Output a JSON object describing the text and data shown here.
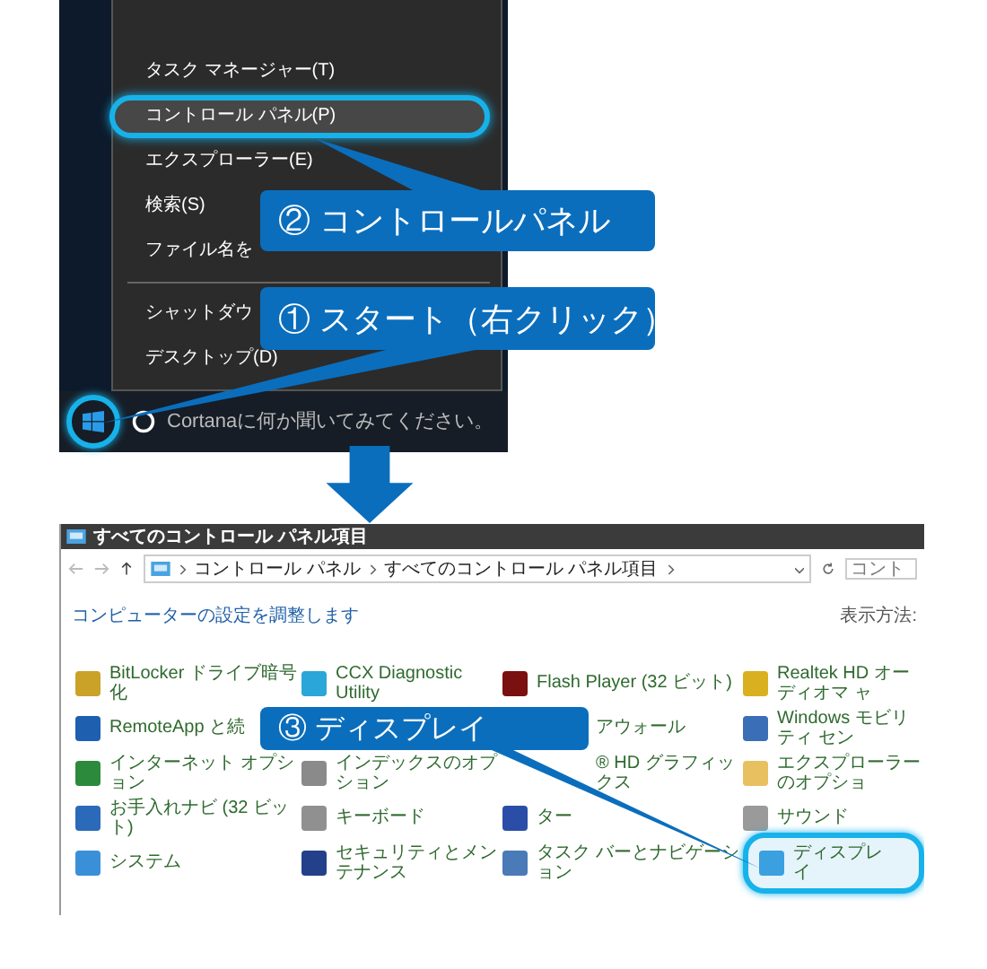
{
  "start_menu": {
    "groups": [
      [
        {
          "label": "タスク マネージャー(T)",
          "selected": false
        },
        {
          "label": "コントロール パネル(P)",
          "selected": true
        },
        {
          "label": "エクスプローラー(E)",
          "selected": false
        },
        {
          "label": "検索(S)",
          "selected": false
        },
        {
          "label": "ファイル名を",
          "selected": false
        }
      ],
      [
        {
          "label": "シャットダウ",
          "selected": false
        },
        {
          "label": "デスクトップ(D)",
          "selected": false
        }
      ]
    ]
  },
  "taskbar": {
    "start_selected": true,
    "search": {
      "placeholder": "Cortanaに何か聞いてみてください。"
    }
  },
  "callouts": [
    {
      "text": "② コントロールパネル"
    },
    {
      "text": "① スタート（右クリック）"
    },
    {
      "text": "③ ディスプレイ"
    }
  ],
  "window": {
    "title": "すべてのコントロール パネル項目",
    "breadcrumb": [
      "コントロール パネル",
      "すべてのコントロール パネル項目"
    ],
    "search": {
      "placeholder": "コント"
    },
    "heading": "コンピューターの設定を調整します",
    "view_label": "表示方法:",
    "items": [
      {
        "kind": "applet",
        "label": "BitLocker ドライブ暗号化",
        "color": "#c9a227",
        "selected": false
      },
      {
        "kind": "applet",
        "label": "CCX Diagnostic Utility",
        "color": "#2aa6d8",
        "selected": false
      },
      {
        "kind": "applet",
        "label": "Flash Player (32 ビット)",
        "color": "#7a1010",
        "selected": false
      },
      {
        "kind": "applet",
        "label": "Realtek HD オーディオマ ャ",
        "color": "#d8b020",
        "selected": false
      },
      {
        "kind": "applet",
        "label": "RemoteApp と続",
        "color": "#1e5fb0",
        "selected": false
      },
      {
        "kind": "hidden"
      },
      {
        "kind": "partial",
        "label": "アウォール",
        "selected": false
      },
      {
        "kind": "applet",
        "label": "Windows モビリティ セン",
        "color": "#3a6fb8",
        "selected": false
      },
      {
        "kind": "applet",
        "label": "インターネット オプション",
        "color": "#2c8a3c",
        "selected": false
      },
      {
        "kind": "applet",
        "label": "インデックスのオプション",
        "color": "#8a8a8a",
        "selected": false
      },
      {
        "kind": "partial",
        "label": "® HD グラフィックス",
        "selected": false
      },
      {
        "kind": "applet",
        "label": "エクスプローラーのオプショ",
        "color": "#e8c060",
        "selected": false
      },
      {
        "kind": "applet",
        "label": "お手入れナビ (32 ビット)",
        "color": "#2a6ab8",
        "selected": false
      },
      {
        "kind": "applet",
        "label": "キーボード",
        "color": "#909090",
        "selected": false
      },
      {
        "kind": "applet",
        "label": "ター",
        "color": "#2a4ea8",
        "selected": false
      },
      {
        "kind": "applet",
        "label": "サウンド",
        "color": "#9a9a9a",
        "selected": false
      },
      {
        "kind": "applet",
        "label": "システム",
        "color": "#3a90d8",
        "selected": false
      },
      {
        "kind": "applet",
        "label": "セキュリティとメンテナンス",
        "color": "#24408a",
        "selected": false
      },
      {
        "kind": "applet",
        "label": "タスク バーとナビゲーション",
        "color": "#4a7ab8",
        "selected": false
      },
      {
        "kind": "applet",
        "label": "ディスプレイ",
        "color": "#3aa0e0",
        "selected": true
      }
    ]
  }
}
